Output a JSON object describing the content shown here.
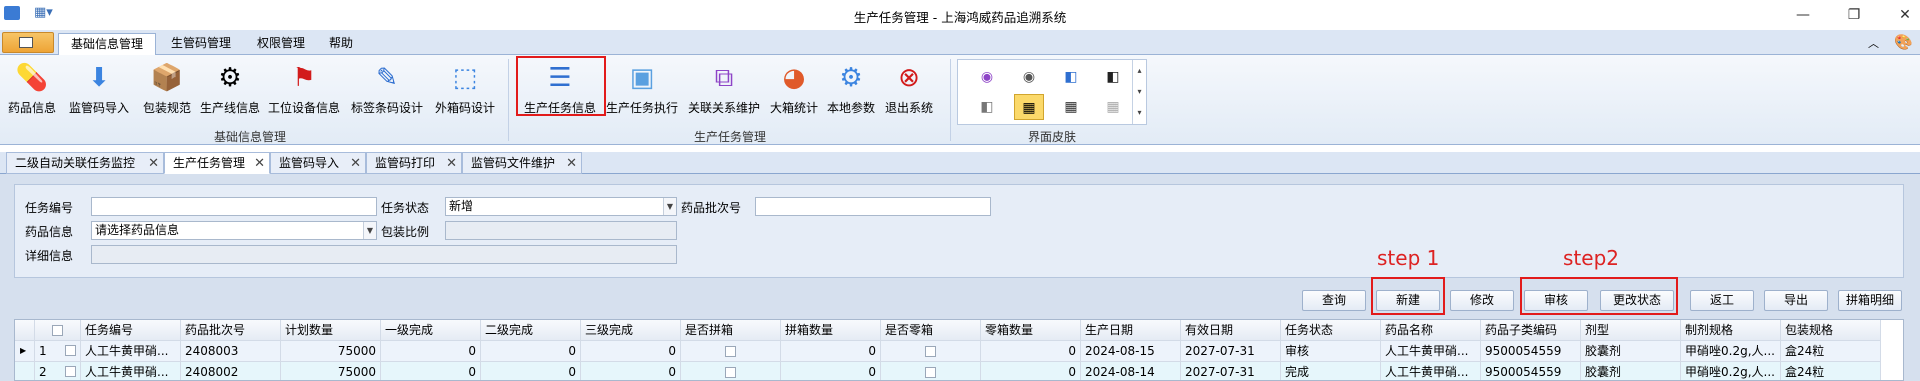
{
  "window": {
    "title": "生产任务管理 - 上海鸿威药品追溯系统"
  },
  "ribbon_tabs": [
    "基础信息管理",
    "生管码管理",
    "权限管理",
    "帮助"
  ],
  "ribbon_groups": {
    "basic": {
      "label": "基础信息管理",
      "buttons": [
        "药品信息",
        "监管码导入",
        "包装规范",
        "生产线信息",
        "工位设备信息",
        "标签条码设计",
        "外箱码设计"
      ]
    },
    "task": {
      "label": "生产任务管理",
      "buttons": [
        "生产任务信息",
        "生产任务执行",
        "关联关系维护",
        "大箱统计",
        "本地参数",
        "退出系统"
      ]
    },
    "skin": {
      "label": "界面皮肤"
    }
  },
  "doc_tabs": [
    "二级自动关联任务监控",
    "生产任务管理",
    "监管码导入",
    "监管码打印",
    "监管码文件维护"
  ],
  "form": {
    "task_no_label": "任务编号",
    "task_no_value": "",
    "task_status_label": "任务状态",
    "task_status_value": "新增",
    "batch_label": "药品批次号",
    "batch_value": "",
    "drug_info_label": "药品信息",
    "drug_info_value": "请选择药品信息",
    "pack_ratio_label": "包装比例",
    "pack_ratio_value": "",
    "detail_label": "详细信息",
    "detail_value": ""
  },
  "toolbar": {
    "query": "查询",
    "new": "新建",
    "modify": "修改",
    "audit": "审核",
    "change_status": "更改状态",
    "rework": "返工",
    "export": "导出",
    "pack_detail": "拼箱明细"
  },
  "annotations": {
    "step1": "step 1",
    "step2": "step2"
  },
  "table": {
    "columns": [
      "任务编号",
      "药品批次号",
      "计划数量",
      "一级完成",
      "二级完成",
      "三级完成",
      "是否拼箱",
      "拼箱数量",
      "是否零箱",
      "零箱数量",
      "生产日期",
      "有效日期",
      "任务状态",
      "药品名称",
      "药品子类编码",
      "剂型",
      "制剂规格",
      "包装规格"
    ],
    "rows": [
      {
        "index": "1",
        "cells": [
          "人工牛黄甲硝...",
          "2408003",
          "75000",
          "0",
          "0",
          "0",
          "",
          "0",
          "",
          "0",
          "2024-08-15",
          "2027-07-31",
          "审核",
          "人工牛黄甲硝...",
          "9500054559",
          "胶囊剂",
          "甲硝唑0.2g,人...",
          "盒24粒"
        ]
      },
      {
        "index": "2",
        "cells": [
          "人工牛黄甲硝...",
          "2408002",
          "75000",
          "0",
          "0",
          "0",
          "",
          "0",
          "",
          "0",
          "2024-08-14",
          "2027-07-31",
          "完成",
          "人工牛黄甲硝...",
          "9500054559",
          "胶囊剂",
          "甲硝唑0.2g,人...",
          "盒24粒"
        ]
      }
    ]
  },
  "colors": {
    "accent_red": "#e21b1b",
    "ribbon_bg": "#dce6f4",
    "content_bg": "#d6e0ee"
  }
}
